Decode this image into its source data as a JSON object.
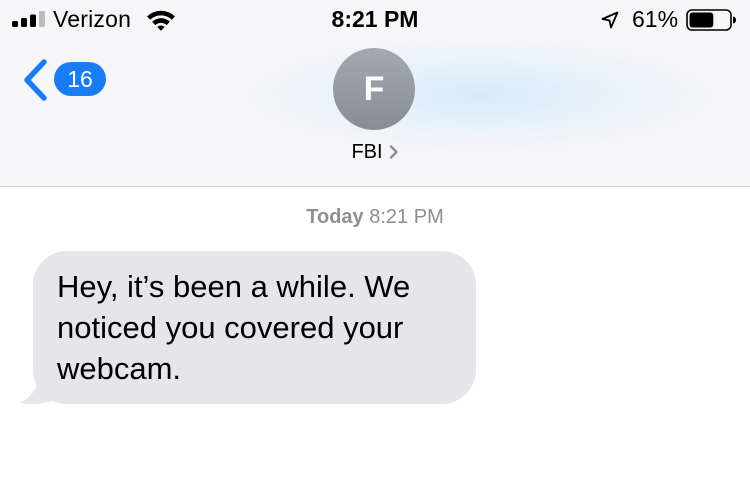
{
  "status_bar": {
    "carrier": "Verizon",
    "time": "8:21 PM",
    "battery_percent": "61%",
    "battery_level": 0.61,
    "signal_bars": 3,
    "signal_bars_total": 4,
    "icons": [
      "signal-bars-icon",
      "wifi-icon",
      "location-arrow-icon",
      "battery-icon"
    ]
  },
  "nav": {
    "back_count": "16",
    "avatar_initial": "F",
    "contact_name": "FBI",
    "icons": [
      "back-chevron-icon",
      "contact-chevron-icon"
    ]
  },
  "conversation": {
    "timestamp_day": "Today",
    "timestamp_time": "8:21 PM",
    "messages": [
      {
        "direction": "incoming",
        "text": "Hey, it’s been a while. We noticed you covered your webcam."
      }
    ]
  },
  "colors": {
    "accent": "#1a7cf5",
    "incoming_bubble": "#e5e5ea",
    "header_bg": "#f6f6f8",
    "timestamp_gray": "#8e8e93",
    "avatar_gray": "#8e939c"
  }
}
